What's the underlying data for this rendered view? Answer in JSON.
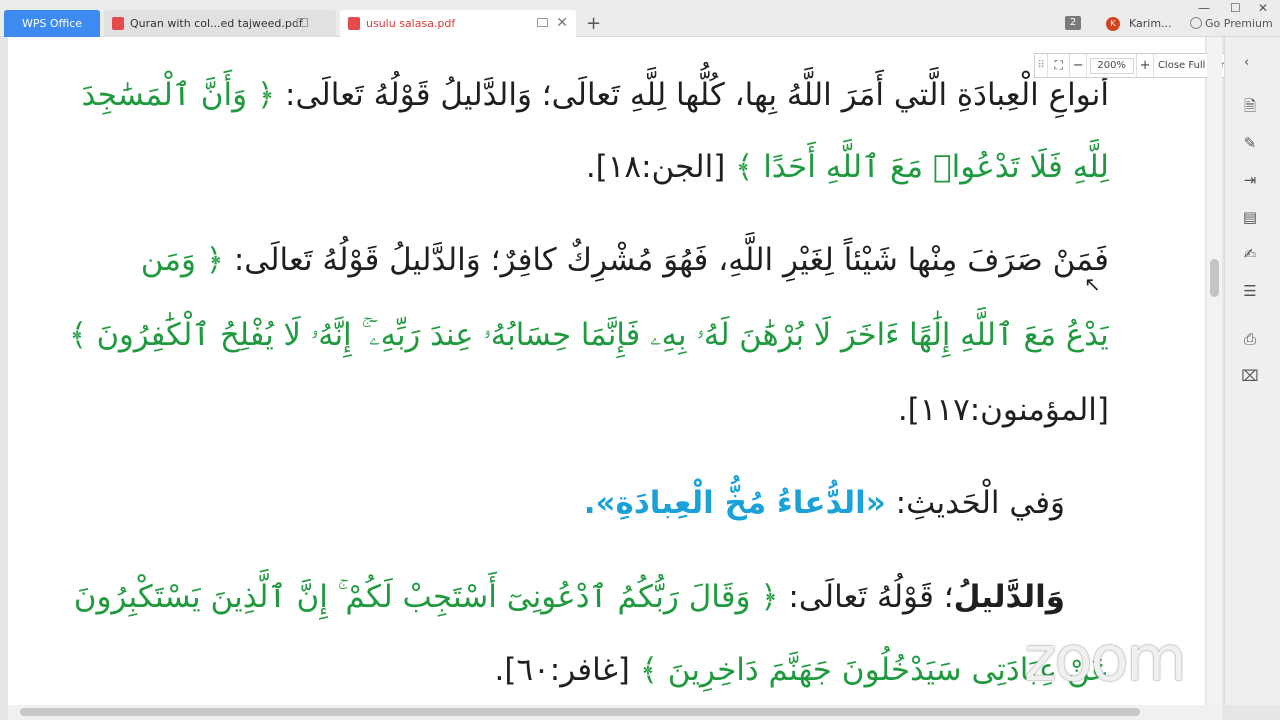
{
  "tabs": {
    "home_label": "WPS Office",
    "doc1_label": "Quran with col...ed tajweed.pdf",
    "doc2_label": "usulu salasa.pdf",
    "new_tab": "+"
  },
  "header": {
    "badge_count": "2",
    "avatar_letter": "K",
    "user_name": "Karim...",
    "premium_label": "Go Premium"
  },
  "zoom_toolbar": {
    "zoom_value": "200%",
    "minus": "−",
    "plus": "+",
    "close_full_screen": "Close Full Screen"
  },
  "document": {
    "line1_black": "أنواعِ الْعِبادَةِ الَّتي أَمَرَ اللَّهُ بِها، كُلُّها لِلَّهِ تَعالَى؛ وَالدَّليلُ قَوْلُهُ تَعالَى:",
    "line1_green": "﴿ وَأَنَّ ٱلْمَسَٰجِدَ",
    "line2_green": "لِلَّهِ فَلَا تَدْعُوا۟ مَعَ ٱللَّهِ أَحَدًا ﴾",
    "line2_black": "[الجن:١٨].",
    "line3_black": "فَمَنْ صَرَفَ مِنْها شَيْئاً لِغَيْرِ اللَّهِ، فَهُوَ مُشْرِكٌ كافِرٌ؛ وَالدَّليلُ قَوْلُهُ تَعالَى:",
    "line3_green": "﴿ وَمَن",
    "line4_green": "يَدْعُ مَعَ ٱللَّهِ إِلَٰهًا ءَاخَرَ لَا بُرْهَٰنَ لَهُۥ بِهِۦ فَإِنَّمَا حِسَابُهُۥ عِندَ رَبِّهِۦٓ ۚ إِنَّهُۥ لَا يُفْلِحُ ٱلْكَٰفِرُونَ ﴾",
    "line5_black": "[المؤمنون:١١٧].",
    "line6_black": "وَفي الْحَديثِ:",
    "line6_blue": "«الدُّعاءُ مُخُّ الْعِبادَةِ».",
    "line7_black_bold": "وَالدَّليلُ",
    "line7_black": "؛ قَوْلُهُ تَعالَى:",
    "line7_green": "﴿ وَقَالَ رَبُّكُمُ ٱدْعُونِىٓ أَسْتَجِبْ لَكُمْ ۚ إِنَّ ٱلَّذِينَ يَسْتَكْبِرُونَ",
    "line8_green": "عَنْ عِبَادَتِى سَيَدْخُلُونَ جَهَنَّمَ دَاخِرِينَ ﴾",
    "line8_black": "[غافر:٦٠]."
  },
  "watermark": "zoom",
  "colors": {
    "quran_green": "#1f9a3e",
    "hadith_blue": "#1aa1d8",
    "wps_blue": "#3d8bf0"
  },
  "icons": [
    "export-pdf-icon",
    "edit-icon",
    "convert-icon",
    "annotate-icon",
    "sign-icon",
    "outline-icon",
    "print-icon",
    "clear-icon"
  ]
}
